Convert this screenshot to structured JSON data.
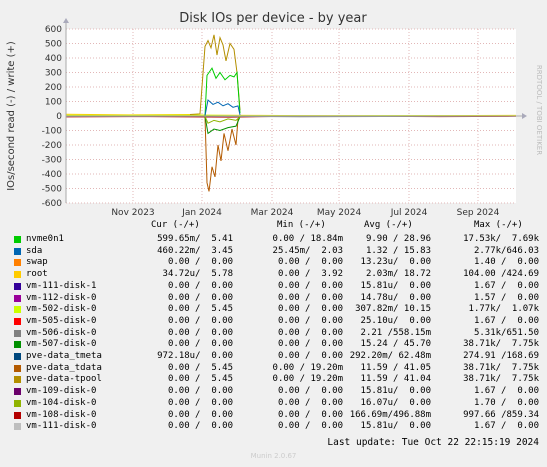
{
  "chart_data": {
    "type": "line",
    "title": "Disk IOs per device - by year",
    "ylabel": "IOs/second read (-) / write (+)",
    "ylim": [
      -600,
      600
    ],
    "yticks": [
      -600,
      -500,
      -400,
      -300,
      -200,
      -100,
      0,
      100,
      200,
      300,
      400,
      500,
      600
    ],
    "xticks": [
      "Nov 2023",
      "Jan 2024",
      "Mar 2024",
      "May 2024",
      "Jul 2024",
      "Sep 2024"
    ],
    "grid": true,
    "side_label": "RRDTOOL / TOBI OETIKER",
    "headers": {
      "cur": "Cur (-/+)",
      "min": "Min (-/+)",
      "avg": "Avg (-/+)",
      "max": "Max (-/+)"
    },
    "series": [
      {
        "name": "nvme0n1",
        "color": "#00cc00",
        "cur": "599.65m/  5.41",
        "min": "0.00 / 18.84m",
        "avg": "9.90 / 28.96",
        "max": "17.53k/  7.69k"
      },
      {
        "name": "sda",
        "color": "#0066b3",
        "cur": "460.22m/  3.45",
        "min": "25.45m/  2.03",
        "avg": "1.32 / 15.83",
        "max": "2.77k/646.03"
      },
      {
        "name": "swap",
        "color": "#ff8000",
        "cur": "0.00 /  0.00",
        "min": "0.00 /  0.00",
        "avg": "13.23u/  0.00",
        "max": "1.40 /  0.00"
      },
      {
        "name": "root",
        "color": "#ffcc00",
        "cur": "34.72u/  5.78",
        "min": "0.00 /  3.92",
        "avg": "2.03m/ 18.72",
        "max": "104.00 /424.69"
      },
      {
        "name": "vm-111-disk-1",
        "color": "#330099",
        "cur": "0.00 /  0.00",
        "min": "0.00 /  0.00",
        "avg": "15.81u/  0.00",
        "max": "1.67 /  0.00"
      },
      {
        "name": "vm-112-disk-0",
        "color": "#990099",
        "cur": "0.00 /  0.00",
        "min": "0.00 /  0.00",
        "avg": "14.78u/  0.00",
        "max": "1.57 /  0.00"
      },
      {
        "name": "vm-502-disk-0",
        "color": "#ccff00",
        "cur": "0.00 /  5.45",
        "min": "0.00 /  0.00",
        "avg": "307.82m/ 10.15",
        "max": "1.77k/  1.07k"
      },
      {
        "name": "vm-505-disk-0",
        "color": "#ff0000",
        "cur": "0.00 /  0.00",
        "min": "0.00 /  0.00",
        "avg": "25.10u/  0.00",
        "max": "1.67 /  0.00"
      },
      {
        "name": "vm-506-disk-0",
        "color": "#808080",
        "cur": "0.00 /  0.00",
        "min": "0.00 /  0.00",
        "avg": "2.21 /558.15m",
        "max": "5.31k/651.50"
      },
      {
        "name": "vm-507-disk-0",
        "color": "#008f00",
        "cur": "0.00 /  0.00",
        "min": "0.00 /  0.00",
        "avg": "15.24 / 45.70",
        "max": "38.71k/  7.75k"
      },
      {
        "name": "pve-data_tmeta",
        "color": "#00487d",
        "cur": "972.18u/  0.00",
        "min": "0.00 /  0.00",
        "avg": "292.20m/ 62.48m",
        "max": "274.91 /168.69"
      },
      {
        "name": "pve-data_tdata",
        "color": "#b35a00",
        "cur": "0.00 /  5.45",
        "min": "0.00 / 19.20m",
        "avg": "11.59 / 41.05",
        "max": "38.71k/  7.75k"
      },
      {
        "name": "pve-data-tpool",
        "color": "#b38f00",
        "cur": "0.00 /  5.45",
        "min": "0.00 / 19.20m",
        "avg": "11.59 / 41.04",
        "max": "38.71k/  7.75k"
      },
      {
        "name": "vm-109-disk-0",
        "color": "#6b006b",
        "cur": "0.00 /  0.00",
        "min": "0.00 /  0.00",
        "avg": "15.81u/  0.00",
        "max": "1.67 /  0.00"
      },
      {
        "name": "vm-104-disk-0",
        "color": "#8fb300",
        "cur": "0.00 /  0.00",
        "min": "0.00 /  0.00",
        "avg": "16.07u/  0.00",
        "max": "1.70 /  0.00"
      },
      {
        "name": "vm-108-disk-0",
        "color": "#b30000",
        "cur": "0.00 /  0.00",
        "min": "0.00 /  0.00",
        "avg": "166.69m/496.88m",
        "max": "997.66 /859.34"
      },
      {
        "name": "vm-111-disk-0",
        "color": "#bebebe",
        "cur": "0.00 /  0.00",
        "min": "0.00 /  0.00",
        "avg": "15.81u/  0.00",
        "max": "1.67 /  0.00"
      }
    ]
  },
  "last_update": "Last update: Tue Oct 22 22:15:19 2024",
  "footer": "Munin 2.0.67"
}
